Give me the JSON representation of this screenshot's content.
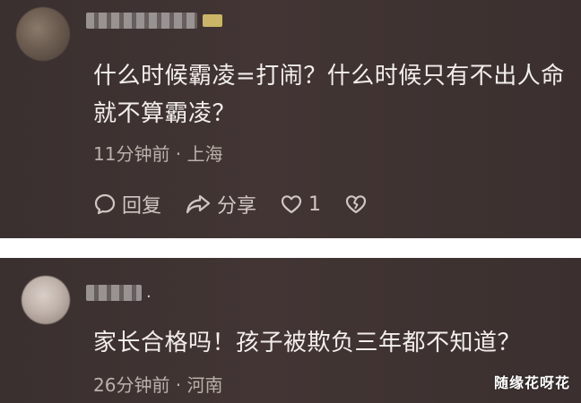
{
  "comments": [
    {
      "text_line1": "什么时候霸凌=打闹？什么时候只有不出人命",
      "text_line2": "就不算霸凌？",
      "meta": "11分钟前 · 上海",
      "actions": {
        "reply_label": "回复",
        "share_label": "分享",
        "like_count": "1"
      }
    },
    {
      "name_suffix": ".",
      "text": "家长合格吗！孩子被欺负三年都不知道？",
      "meta": "26分钟前 · 河南"
    }
  ],
  "watermark": "随缘花呀花",
  "colors": {
    "background": "#3e3231",
    "text": "#f2eeec",
    "meta": "#bcb0ab",
    "icon": "#d0c6c2"
  },
  "icons": [
    "comment-bubble-icon",
    "share-arrow-icon",
    "heart-icon",
    "broken-heart-icon"
  ]
}
